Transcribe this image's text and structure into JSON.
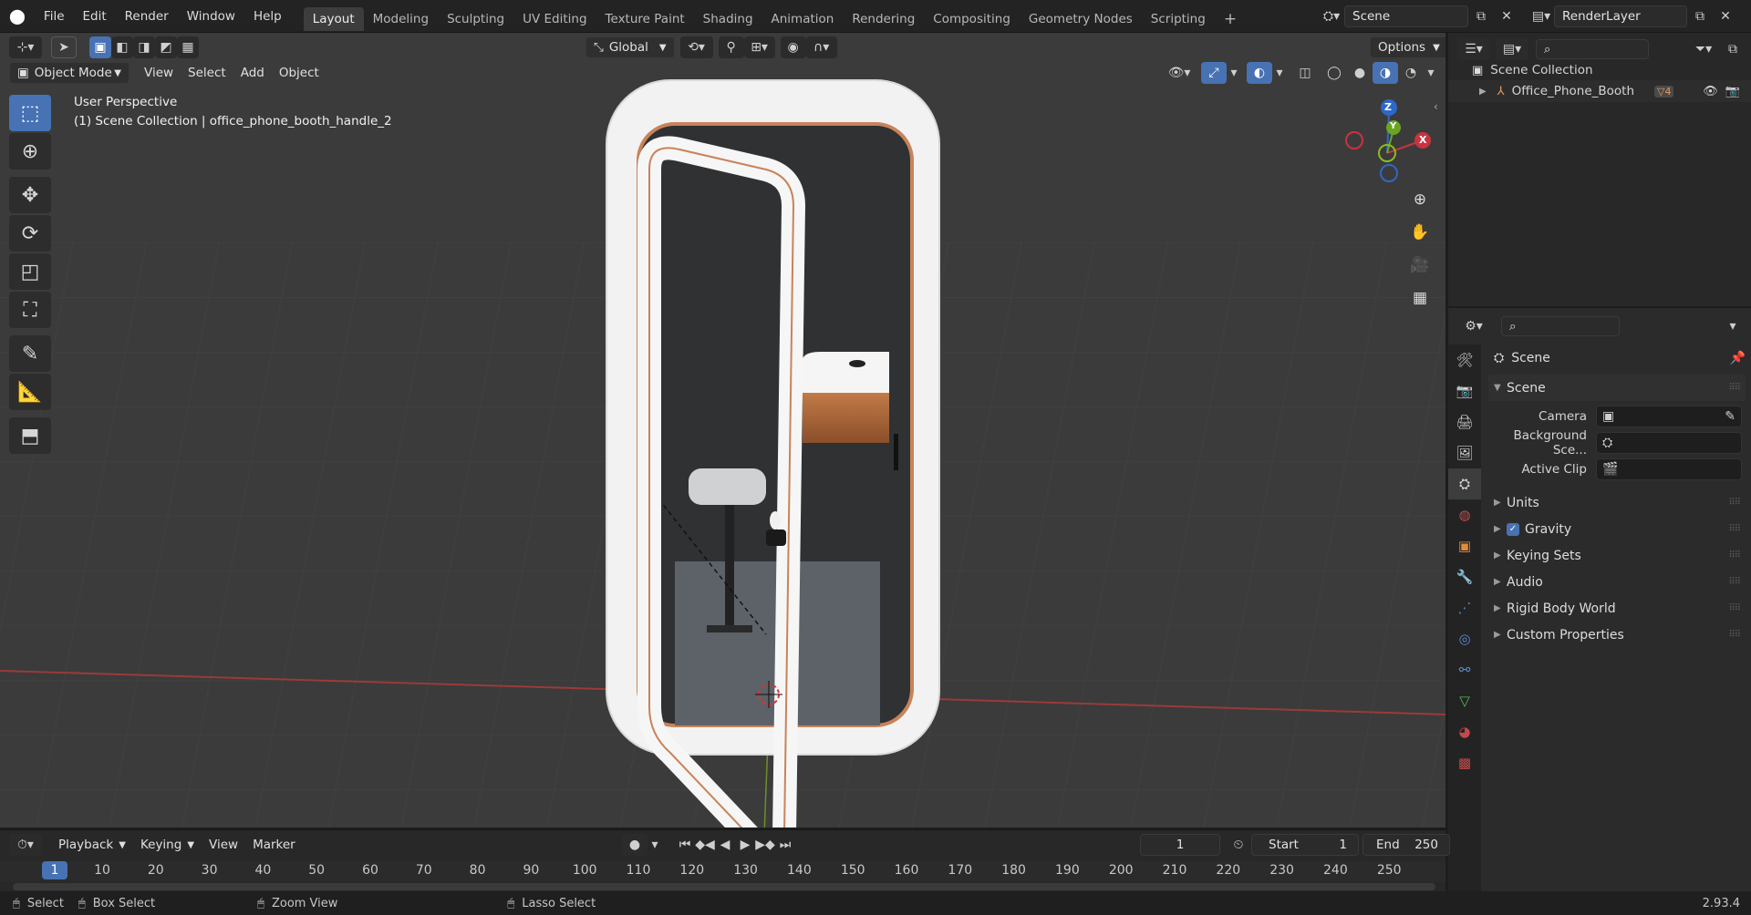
{
  "menu": [
    "File",
    "Edit",
    "Render",
    "Window",
    "Help"
  ],
  "workspaces": [
    {
      "label": "Layout",
      "active": true
    },
    {
      "label": "Modeling",
      "active": false
    },
    {
      "label": "Sculpting",
      "active": false
    },
    {
      "label": "UV Editing",
      "active": false
    },
    {
      "label": "Texture Paint",
      "active": false
    },
    {
      "label": "Shading",
      "active": false
    },
    {
      "label": "Animation",
      "active": false
    },
    {
      "label": "Rendering",
      "active": false
    },
    {
      "label": "Compositing",
      "active": false
    },
    {
      "label": "Geometry Nodes",
      "active": false
    },
    {
      "label": "Scripting",
      "active": false
    }
  ],
  "add_workspace": "+",
  "scene_field": "Scene",
  "render_layer_field": "RenderLayer",
  "viewport": {
    "mode": "Object Mode",
    "header_menus": [
      "View",
      "Select",
      "Add",
      "Object"
    ],
    "orientation": "Global",
    "options": "Options",
    "perspective": "User Perspective",
    "context": "(1) Scene Collection | office_phone_booth_handle_2"
  },
  "gizmo": {
    "z": "Z",
    "y": "Y",
    "x": "X"
  },
  "outliner": {
    "root": "Scene Collection",
    "items": [
      {
        "label": "Office_Phone_Booth",
        "badge": "4"
      }
    ]
  },
  "properties": {
    "title": "Scene",
    "section": "Scene",
    "fields": [
      {
        "label": "Camera"
      },
      {
        "label": "Background Sce..."
      },
      {
        "label": "Active Clip"
      }
    ],
    "collapsed": [
      {
        "label": "Units",
        "checkbox": false
      },
      {
        "label": "Gravity",
        "checkbox": true
      },
      {
        "label": "Keying Sets",
        "checkbox": false
      },
      {
        "label": "Audio",
        "checkbox": false
      },
      {
        "label": "Rigid Body World",
        "checkbox": false
      },
      {
        "label": "Custom Properties",
        "checkbox": false
      }
    ]
  },
  "timeline": {
    "menus": [
      "Playback",
      "Keying",
      "View",
      "Marker"
    ],
    "current_frame": "1",
    "start_label": "Start",
    "start": "1",
    "end_label": "End",
    "end": "250",
    "ticks": [
      "1",
      "10",
      "20",
      "30",
      "40",
      "50",
      "60",
      "70",
      "80",
      "90",
      "100",
      "110",
      "120",
      "130",
      "140",
      "150",
      "160",
      "170",
      "180",
      "190",
      "200",
      "210",
      "220",
      "230",
      "240",
      "250"
    ]
  },
  "status": {
    "select": "Select",
    "box_select": "Box Select",
    "zoom_view": "Zoom View",
    "lasso_select": "Lasso Select",
    "version": "2.93.4"
  }
}
